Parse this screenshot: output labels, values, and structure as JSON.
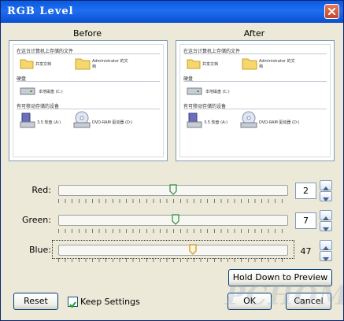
{
  "window": {
    "title": "RGB Level"
  },
  "before": {
    "label": "Before"
  },
  "after": {
    "label": "After"
  },
  "preview": {
    "section_files": "在这台计算机上存储的文件",
    "shared_docs": "共享文档",
    "admin_docs": "Administrator 的文档",
    "section_drives": "硬盘",
    "local_disk": "本地磁盘 (C:)",
    "section_removable": "有可移动存储的设备",
    "floppy": "3.5 软盘 (A:)",
    "dvd": "DVD-RAM 驱动器 (D:)"
  },
  "sliders": {
    "red": {
      "label": "Red:",
      "value": "2",
      "level": 0.5
    },
    "green": {
      "label": "Green:",
      "value": "7",
      "level": 0.51
    },
    "blue": {
      "label": "Blue:",
      "value": "47",
      "level": 0.59
    }
  },
  "buttons": {
    "hold_preview": "Hold Down to Preview",
    "reset": "Reset",
    "ok": "OK",
    "cancel": "Cancel"
  },
  "keep_settings": {
    "label": "Keep Settings",
    "checked": true
  },
  "watermark": "PCHOME"
}
